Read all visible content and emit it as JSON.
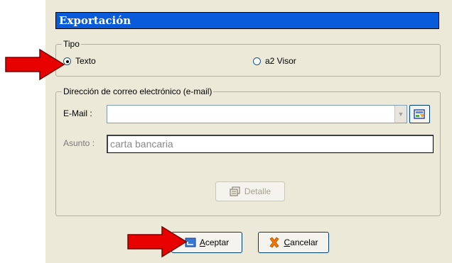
{
  "dialog": {
    "title": "Exportación"
  },
  "tipo": {
    "legend": "Tipo",
    "options": [
      {
        "label": "Texto",
        "checked": true
      },
      {
        "label": "a2 Visor",
        "checked": false
      }
    ]
  },
  "email_group": {
    "legend": "Dirección de correo electrónico (e-mail)",
    "email_label": "E-Mail :",
    "email_value": "",
    "subject_label": "Asunto :",
    "subject_value": "carta bancaria",
    "detail_button": "Detalle"
  },
  "buttons": {
    "accept_first": "A",
    "accept_rest": "ceptar",
    "cancel_first": "C",
    "cancel_rest": "ancelar"
  },
  "colors": {
    "titlebar": "#0a5bd9",
    "dialog_bg": "#ece9d8",
    "arrow": "#e60000"
  },
  "icons": [
    "arrow-pointer-icon",
    "address-book-icon",
    "dropdown-arrow-icon",
    "detail-icon",
    "accept-icon",
    "cancel-x-icon"
  ]
}
